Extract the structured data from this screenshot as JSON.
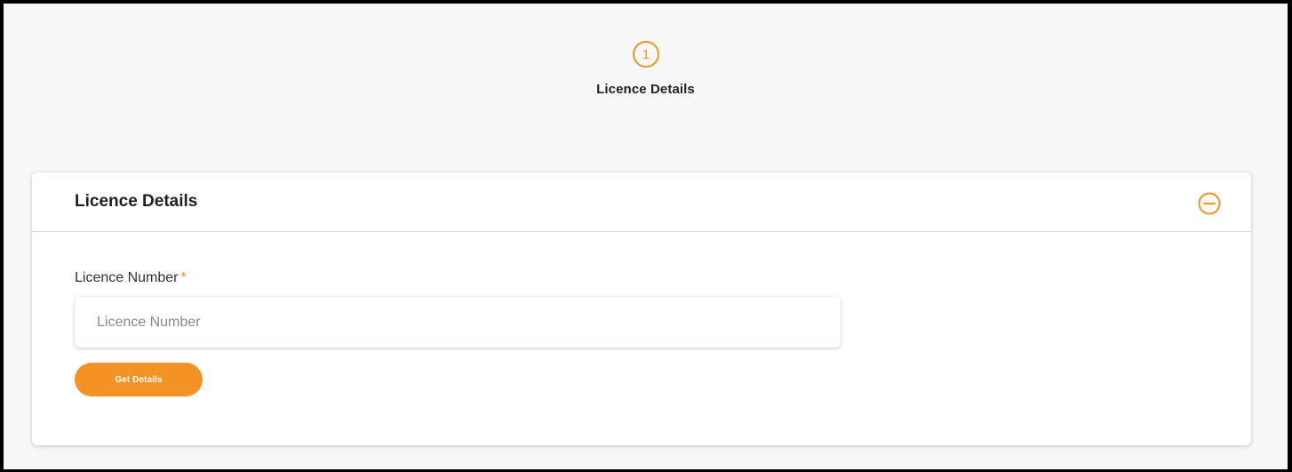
{
  "stepper": {
    "steps": [
      {
        "number": "1",
        "label": "Licence Details"
      }
    ]
  },
  "card": {
    "title": "Licence Details",
    "collapse_icon": "minus-circle-icon"
  },
  "form": {
    "licence_number": {
      "label": "Licence Number",
      "required_marker": "*",
      "placeholder": "Licence Number",
      "value": ""
    },
    "submit_label": "Get Details"
  },
  "colors": {
    "accent": "#f39325",
    "page_background": "#f7f7f7",
    "card_background": "#ffffff"
  }
}
